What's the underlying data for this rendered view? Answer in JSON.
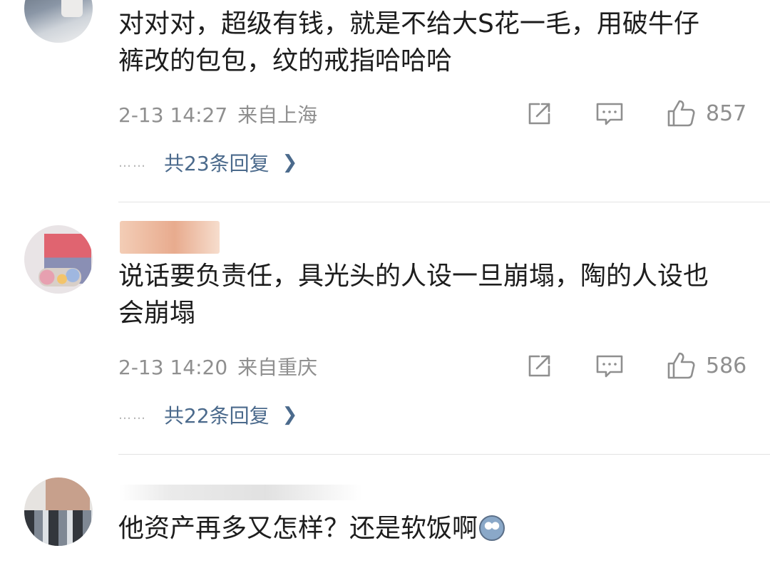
{
  "comments": [
    {
      "text": "对对对，超级有钱，就是不给大S花一毛，用破牛仔\n裤改的包包，纹的戒指哈哈哈",
      "date": "2-13 14:27",
      "location": "来自上海",
      "likes": "857",
      "replies_label": "共23条回复",
      "dots": "……"
    },
    {
      "text": "说话要负责任，具光头的人设一旦崩塌，陶的人设也\n会崩塌",
      "date": "2-13 14:20",
      "location": "来自重庆",
      "likes": "586",
      "replies_label": "共22条回复",
      "dots": "……"
    },
    {
      "text": "他资产再多又怎样？还是软饭啊"
    }
  ],
  "icons": [
    "share-icon",
    "comment-icon",
    "like-icon",
    "chevron-right-icon",
    "emoji-icon"
  ],
  "colors": {
    "text": "#1d1d1d",
    "meta": "#8f8f8f",
    "link": "#4b6a8c",
    "divider": "#e3e3e3"
  }
}
